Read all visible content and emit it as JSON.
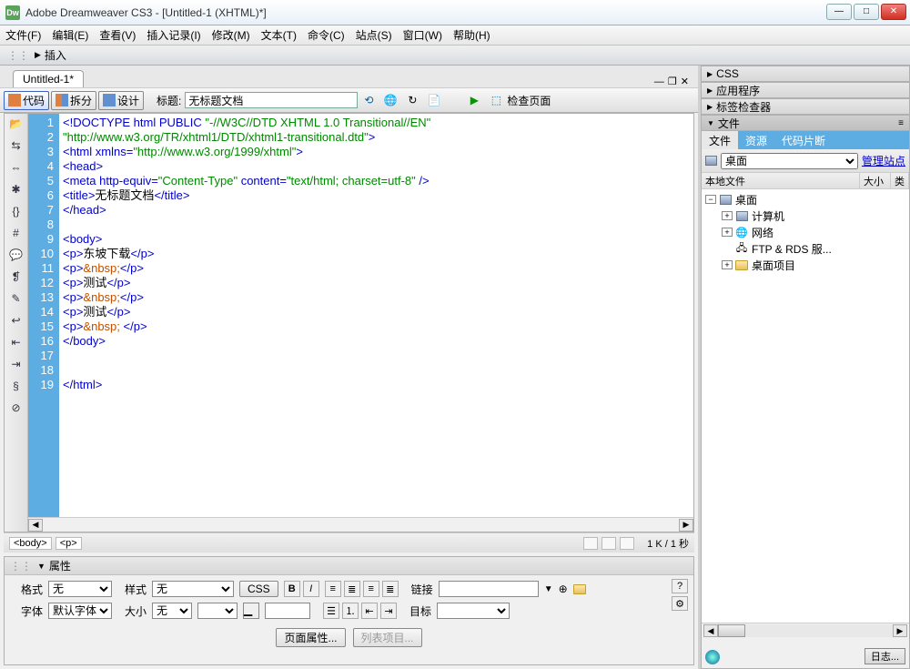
{
  "titlebar": {
    "app_icon": "Dw",
    "text": "Adobe Dreamweaver CS3 - [Untitled-1 (XHTML)*]"
  },
  "menubar": [
    "文件(F)",
    "编辑(E)",
    "查看(V)",
    "插入记录(I)",
    "修改(M)",
    "文本(T)",
    "命令(C)",
    "站点(S)",
    "窗口(W)",
    "帮助(H)"
  ],
  "insertbar": {
    "label": "插入"
  },
  "doc_tab": {
    "label": "Untitled-1*"
  },
  "doctoolbar": {
    "views": {
      "code": "代码",
      "split": "拆分",
      "design": "设计"
    },
    "title_label": "标题:",
    "title_value": "无标题文档",
    "check_page": "检查页面"
  },
  "code_lines": [
    {
      "n": 1,
      "html": "<span class='tag'>&lt;!DOCTYPE html PUBLIC </span><span class='str'>\"-//W3C//DTD XHTML 1.0 Transitional//EN\"</span>"
    },
    {
      "n": "",
      "html": "<span class='str'>\"http://www.w3.org/TR/xhtml1/DTD/xhtml1-transitional.dtd\"</span><span class='tag'>&gt;</span>"
    },
    {
      "n": 2,
      "html": "<span class='tag'>&lt;html xmlns=</span><span class='str'>\"http://www.w3.org/1999/xhtml\"</span><span class='tag'>&gt;</span>"
    },
    {
      "n": 3,
      "html": "<span class='tag'>&lt;head&gt;</span>"
    },
    {
      "n": 4,
      "html": "<span class='tag'>&lt;meta http-equiv=</span><span class='str'>\"Content-Type\"</span><span class='tag'> content=</span><span class='str'>\"text/html; charset=utf-8\"</span><span class='tag'> /&gt;</span>"
    },
    {
      "n": 5,
      "html": "<span class='tag'>&lt;title&gt;</span><span class='txt'>无标题文档</span><span class='tag'>&lt;/title&gt;</span>"
    },
    {
      "n": 6,
      "html": "<span class='tag'>&lt;/head&gt;</span>"
    },
    {
      "n": 7,
      "html": ""
    },
    {
      "n": 8,
      "html": "<span class='tag'>&lt;body&gt;</span>"
    },
    {
      "n": 9,
      "html": "<span class='tag'>&lt;p&gt;</span><span class='txt'>东坡下载</span><span class='tag'>&lt;/p&gt;</span>"
    },
    {
      "n": 10,
      "html": "<span class='tag'>&lt;p&gt;</span><span class='ent'>&amp;nbsp;</span><span class='tag'>&lt;/p&gt;</span>"
    },
    {
      "n": 11,
      "html": "<span class='tag'>&lt;p&gt;</span><span class='txt'>测试</span><span class='tag'>&lt;/p&gt;</span>"
    },
    {
      "n": 12,
      "html": "<span class='tag'>&lt;p&gt;</span><span class='ent'>&amp;nbsp;</span><span class='tag'>&lt;/p&gt;</span>"
    },
    {
      "n": 13,
      "html": "<span class='tag'>&lt;p&gt;</span><span class='txt'>测试</span><span class='tag'>&lt;/p&gt;</span>"
    },
    {
      "n": 14,
      "html": "<span class='tag'>&lt;p&gt;</span><span class='ent'>&amp;nbsp;</span> <span class='tag'>&lt;/p&gt;</span>"
    },
    {
      "n": 15,
      "html": "<span class='tag'>&lt;/body&gt;</span>"
    },
    {
      "n": 16,
      "html": ""
    },
    {
      "n": 17,
      "html": ""
    },
    {
      "n": 18,
      "html": "<span class='tag'>&lt;/html&gt;</span>"
    },
    {
      "n": 19,
      "html": ""
    }
  ],
  "statusbar": {
    "tag_selector1": "<body>",
    "tag_selector2": "<p>",
    "size_info": "1 K / 1 秒"
  },
  "properties": {
    "header": "属性",
    "format_label": "格式",
    "format_value": "无",
    "style_label": "样式",
    "style_value": "无",
    "css_btn": "CSS",
    "link_label": "链接",
    "font_label": "字体",
    "font_value": "默认字体",
    "size_label": "大小",
    "size_value": "无",
    "target_label": "目标",
    "page_props_btn": "页面属性...",
    "list_item_btn": "列表项目..."
  },
  "right_panels": {
    "css": "CSS",
    "app": "应用程序",
    "tag_inspector": "标签检查器",
    "files": "文件",
    "files_tabs": [
      "文件",
      "资源",
      "代码片断"
    ],
    "site_selector": "桌面",
    "manage_sites": "管理站点",
    "columns": {
      "local": "本地文件",
      "size": "大小",
      "type": "类"
    },
    "tree": [
      {
        "indent": 0,
        "toggle": "−",
        "icon": "pc",
        "label": "桌面"
      },
      {
        "indent": 1,
        "toggle": "+",
        "icon": "pc",
        "label": "计算机"
      },
      {
        "indent": 1,
        "toggle": "+",
        "icon": "net",
        "label": "网络"
      },
      {
        "indent": 1,
        "toggle": "",
        "icon": "ftp",
        "label": "FTP & RDS 服..."
      },
      {
        "indent": 1,
        "toggle": "+",
        "icon": "folder",
        "label": "桌面项目"
      }
    ],
    "log_btn": "日志..."
  }
}
